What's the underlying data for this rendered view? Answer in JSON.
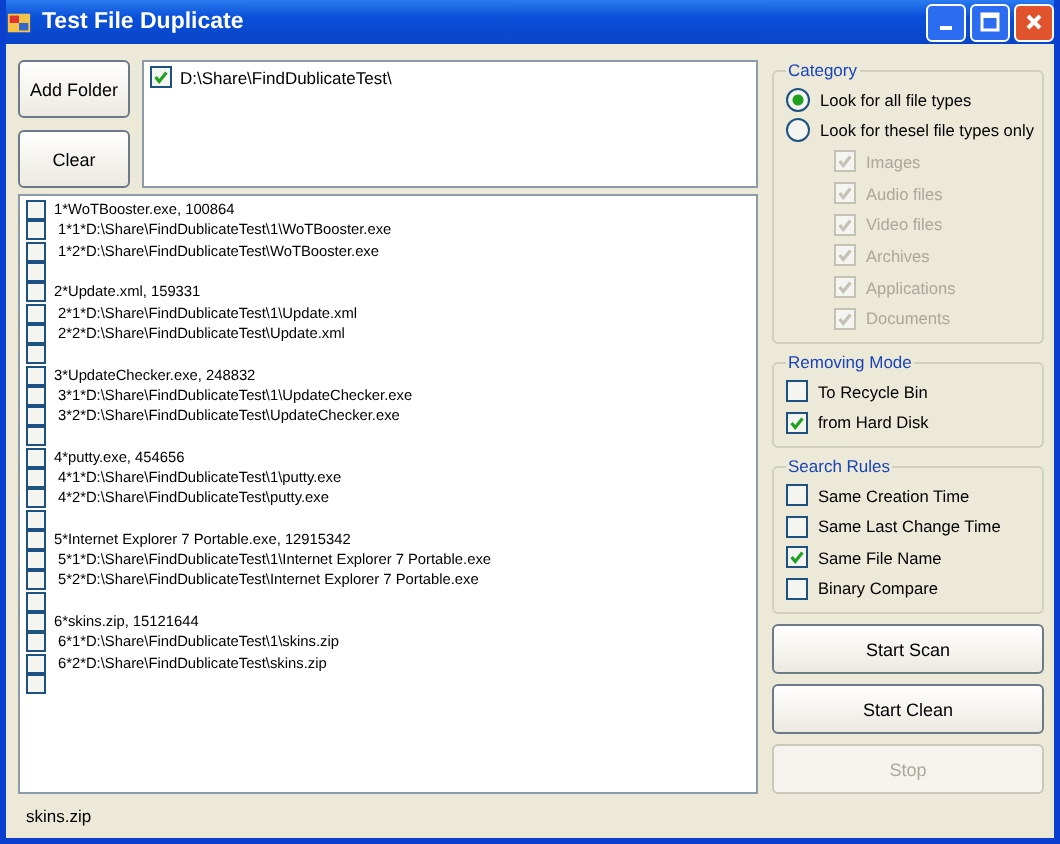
{
  "window": {
    "title": "Test File Duplicate"
  },
  "buttons": {
    "add_folder": "Add Folder",
    "clear": "Clear"
  },
  "folders": [
    {
      "path": "D:\\Share\\FindDublicateTest\\",
      "checked": true
    }
  ],
  "files": [
    {
      "kind": "group",
      "text": "1*WoTBooster.exe,  100864",
      "checked": false
    },
    {
      "kind": "path",
      "text": "1*1*D:\\Share\\FindDublicateTest\\1\\WoTBooster.exe",
      "checked": false
    },
    {
      "kind": "path",
      "text": "1*2*D:\\Share\\FindDublicateTest\\WoTBooster.exe",
      "checked": false
    },
    {
      "kind": "blank",
      "checked": false
    },
    {
      "kind": "group",
      "text": "2*Update.xml,  159331",
      "checked": false
    },
    {
      "kind": "path",
      "text": "2*1*D:\\Share\\FindDublicateTest\\1\\Update.xml",
      "checked": false
    },
    {
      "kind": "path",
      "text": "2*2*D:\\Share\\FindDublicateTest\\Update.xml",
      "checked": false
    },
    {
      "kind": "blank",
      "checked": false
    },
    {
      "kind": "group",
      "text": "3*UpdateChecker.exe,  248832",
      "checked": false
    },
    {
      "kind": "path",
      "text": "3*1*D:\\Share\\FindDublicateTest\\1\\UpdateChecker.exe",
      "checked": false
    },
    {
      "kind": "path",
      "text": "3*2*D:\\Share\\FindDublicateTest\\UpdateChecker.exe",
      "checked": false
    },
    {
      "kind": "blank",
      "checked": false
    },
    {
      "kind": "group",
      "text": "4*putty.exe,  454656",
      "checked": false
    },
    {
      "kind": "path",
      "text": "4*1*D:\\Share\\FindDublicateTest\\1\\putty.exe",
      "checked": false
    },
    {
      "kind": "path",
      "text": "4*2*D:\\Share\\FindDublicateTest\\putty.exe",
      "checked": false
    },
    {
      "kind": "blank",
      "checked": false
    },
    {
      "kind": "group",
      "text": "5*Internet Explorer 7 Portable.exe,  12915342",
      "checked": false
    },
    {
      "kind": "path",
      "text": "5*1*D:\\Share\\FindDublicateTest\\1\\Internet Explorer 7 Portable.exe",
      "checked": false
    },
    {
      "kind": "path",
      "text": "5*2*D:\\Share\\FindDublicateTest\\Internet Explorer 7 Portable.exe",
      "checked": false
    },
    {
      "kind": "blank",
      "checked": false
    },
    {
      "kind": "group",
      "text": "6*skins.zip,  15121644",
      "checked": false
    },
    {
      "kind": "path",
      "text": "6*1*D:\\Share\\FindDublicateTest\\1\\skins.zip",
      "checked": false
    },
    {
      "kind": "path",
      "text": "6*2*D:\\Share\\FindDublicateTest\\skins.zip",
      "checked": false
    },
    {
      "kind": "blank",
      "checked": false
    }
  ],
  "category": {
    "title": "Category",
    "options": [
      {
        "label": "Look for all file types",
        "selected": true
      },
      {
        "label": "Look for thesel file types only",
        "selected": false
      }
    ],
    "types": [
      {
        "label": "Images",
        "checked": true,
        "disabled": true
      },
      {
        "label": "Audio files",
        "checked": true,
        "disabled": true
      },
      {
        "label": "Video files",
        "checked": true,
        "disabled": true
      },
      {
        "label": "Archives",
        "checked": true,
        "disabled": true
      },
      {
        "label": "Applications",
        "checked": true,
        "disabled": true
      },
      {
        "label": "Documents",
        "checked": true,
        "disabled": true
      }
    ]
  },
  "removing_mode": {
    "title": "Removing Mode",
    "options": [
      {
        "label": "To Recycle Bin",
        "checked": false
      },
      {
        "label": "from Hard Disk",
        "checked": true
      }
    ]
  },
  "search_rules": {
    "title": "Search Rules",
    "options": [
      {
        "label": "Same Creation Time",
        "checked": false
      },
      {
        "label": "Same Last Change Time",
        "checked": false
      },
      {
        "label": "Same File Name",
        "checked": true
      },
      {
        "label": "Binary Compare",
        "checked": false
      }
    ]
  },
  "actions": [
    {
      "label": "Start Scan",
      "disabled": false
    },
    {
      "label": "Start Clean",
      "disabled": false
    },
    {
      "label": "Stop",
      "disabled": true
    }
  ],
  "status_bar": "skins.zip"
}
